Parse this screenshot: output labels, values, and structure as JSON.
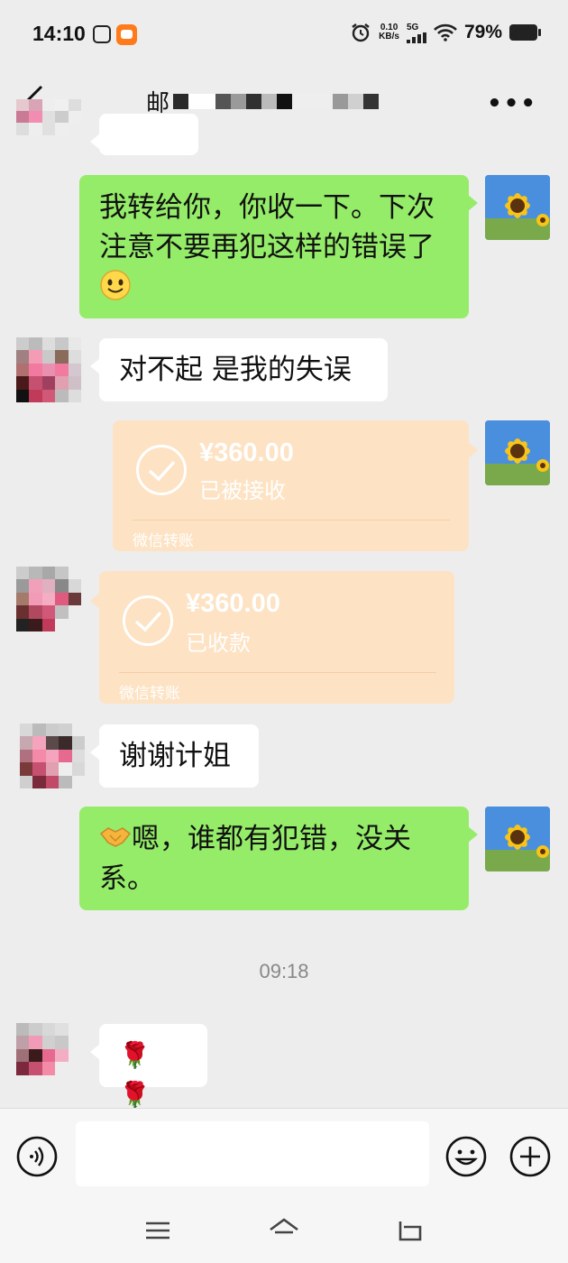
{
  "status_bar": {
    "time": "14:10",
    "net_speed_value": "0.10",
    "net_speed_unit": "KB/s",
    "network": "5G",
    "battery": "79%"
  },
  "header": {
    "title": "邮"
  },
  "messages": {
    "msg1": "我转给你，你收一下。下次注意不要再犯这样的错误了",
    "msg2": "对不起 是我的失误",
    "transfer1": {
      "amount": "¥360.00",
      "status": "已被接收",
      "footer": "微信转账"
    },
    "transfer2": {
      "amount": "¥360.00",
      "status": "已收款",
      "footer": "微信转账"
    },
    "msg3": "谢谢计姐",
    "msg4": "嗯，谁都有犯错，没关系。",
    "timestamp": "09:18",
    "msg5": "🌹 🌹"
  },
  "icons": {
    "emoji_smile": "slightly-smiling-face",
    "emoji_handshake": "handshake",
    "voice": "voice-icon",
    "emoji_panel": "emoji-icon",
    "plus": "plus-icon"
  },
  "colors": {
    "self_bubble": "#95ec69",
    "other_bubble": "#ffffff",
    "transfer": "#fde2c3",
    "background": "#ededed"
  }
}
